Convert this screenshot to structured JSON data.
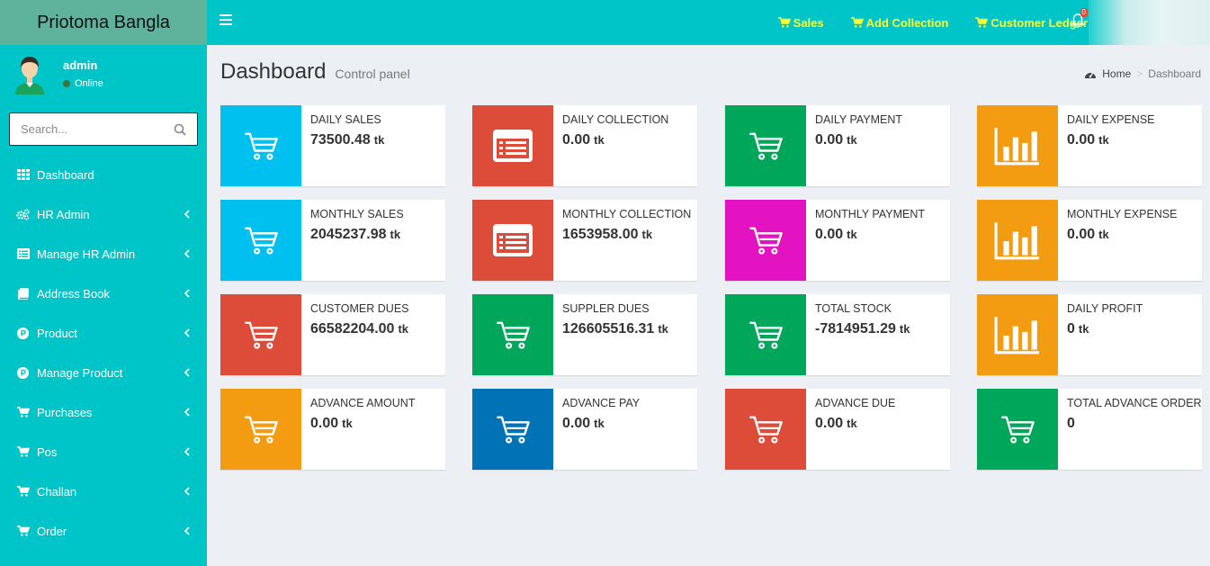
{
  "logo": "Priotoma Bangla",
  "colors": {
    "header": "#00c5c8",
    "logo_bg": "#5fb39d",
    "nav_link": "#ffff33"
  },
  "nav": {
    "links": [
      {
        "label": "Sales",
        "icon": "cart-icon"
      },
      {
        "label": "Add Collection",
        "icon": "cart-icon"
      },
      {
        "label": "Customer Ledger",
        "icon": "cart-icon"
      }
    ],
    "notifications": "0"
  },
  "user": {
    "name": "admin",
    "status": "Online"
  },
  "search": {
    "placeholder": "Search..."
  },
  "sidebar": {
    "items": [
      {
        "label": "Dashboard",
        "icon": "grid-icon",
        "has_children": false
      },
      {
        "label": "HR Admin",
        "icon": "cogs-icon",
        "has_children": true
      },
      {
        "label": "Manage HR Admin",
        "icon": "list-icon",
        "has_children": true
      },
      {
        "label": "Address Book",
        "icon": "book-icon",
        "has_children": true
      },
      {
        "label": "Product",
        "icon": "product-hunt-icon",
        "has_children": true
      },
      {
        "label": "Manage Product",
        "icon": "product-hunt-icon",
        "has_children": true
      },
      {
        "label": "Purchases",
        "icon": "cart-icon",
        "has_children": true
      },
      {
        "label": "Pos",
        "icon": "cart-icon",
        "has_children": true
      },
      {
        "label": "Challan",
        "icon": "cart-icon",
        "has_children": true
      },
      {
        "label": "Order",
        "icon": "cart-icon",
        "has_children": true
      }
    ]
  },
  "page": {
    "title": "Dashboard",
    "subtitle": "Control panel"
  },
  "breadcrumb": {
    "home": "Home",
    "current": "Dashboard"
  },
  "boxes": [
    {
      "label": "DAILY SALES",
      "value": "73500.48",
      "unit": "tk",
      "color": "#00c0ef",
      "icon": "cart-icon"
    },
    {
      "label": "DAILY COLLECTION",
      "value": "0.00",
      "unit": "tk",
      "color": "#dd4b39",
      "icon": "list-alt-icon"
    },
    {
      "label": "DAILY PAYMENT",
      "value": "0.00",
      "unit": "tk",
      "color": "#00a65a",
      "icon": "cart-icon"
    },
    {
      "label": "DAILY EXPENSE",
      "value": "0.00",
      "unit": "tk",
      "color": "#f39c12",
      "icon": "bar-chart-icon"
    },
    {
      "label": "MONTHLY SALES",
      "value": "2045237.98",
      "unit": "tk",
      "color": "#00c0ef",
      "icon": "cart-icon"
    },
    {
      "label": "MONTHLY COLLECTION",
      "value": "1653958.00",
      "unit": "tk",
      "color": "#dd4b39",
      "icon": "list-alt-icon"
    },
    {
      "label": "MONTHLY PAYMENT",
      "value": "0.00",
      "unit": "tk",
      "color": "#e313c2",
      "icon": "cart-icon"
    },
    {
      "label": "MONTHLY EXPENSE",
      "value": "0.00",
      "unit": "tk",
      "color": "#f39c12",
      "icon": "bar-chart-icon"
    },
    {
      "label": "CUSTOMER DUES",
      "value": "66582204.00",
      "unit": "tk",
      "color": "#dd4b39",
      "icon": "cart-icon"
    },
    {
      "label": "SUPPLER DUES",
      "value": "126605516.31",
      "unit": "tk",
      "color": "#00a65a",
      "icon": "cart-icon"
    },
    {
      "label": "TOTAL STOCK",
      "value": "-7814951.29",
      "unit": "tk",
      "color": "#00a65a",
      "icon": "cart-icon"
    },
    {
      "label": "DAILY PROFIT",
      "value": "0",
      "unit": "tk",
      "color": "#f39c12",
      "icon": "bar-chart-icon"
    },
    {
      "label": "ADVANCE AMOUNT",
      "value": "0.00",
      "unit": "tk",
      "color": "#f39c12",
      "icon": "cart-icon"
    },
    {
      "label": "ADVANCE PAY",
      "value": "0.00",
      "unit": "tk",
      "color": "#0073b7",
      "icon": "cart-icon"
    },
    {
      "label": "ADVANCE DUE",
      "value": "0.00",
      "unit": "tk",
      "color": "#dd4b39",
      "icon": "cart-icon"
    },
    {
      "label": "TOTAL ADVANCE ORDER",
      "value": "0",
      "unit": "",
      "color": "#00a65a",
      "icon": "cart-icon"
    }
  ]
}
